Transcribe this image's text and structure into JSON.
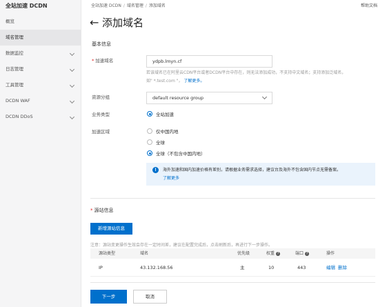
{
  "sidebar": {
    "title": "全站加速 DCDN",
    "items": [
      {
        "label": "概览",
        "expandable": false
      },
      {
        "label": "域名管理",
        "expandable": false,
        "active": true
      },
      {
        "label": "数据监控",
        "expandable": true
      },
      {
        "label": "日志管理",
        "expandable": true
      },
      {
        "label": "工具管理",
        "expandable": true
      },
      {
        "label": "DCDN WAF",
        "expandable": true
      },
      {
        "label": "DCDN DDoS",
        "expandable": true
      }
    ]
  },
  "topbar": {
    "breadcrumb": [
      "全站加速 DCDN",
      "域名管理",
      "添加域名"
    ],
    "help": "帮助文档"
  },
  "header": {
    "back": "←",
    "title": "添加域名"
  },
  "basic": {
    "section_title": "基本信息",
    "domain_label": "加速域名",
    "domain_value": "ydpb.lmyn.cf",
    "hint_line1": "若该域名已在阿里云CDN平台或者DCDN平台中存在，则无法添加成功，不支持中文域名；支持添加泛域名，",
    "hint_line2": "如\" *.test.com \"，",
    "hint_link": "了解更多。",
    "resource_label": "资源分组",
    "resource_value": "default resource group",
    "biz_label": "业务类型",
    "biz_options": [
      "全站加速"
    ],
    "region_label": "加速区域",
    "region_options": [
      "仅中国内地",
      "全球",
      "全球（不包含中国内地）"
    ],
    "info_line1": "海外加速和国内加速价格有差别，请根据业务需求选择，建议台及海外不包含国内节点无需备案。",
    "info_link": "了解更多"
  },
  "origin": {
    "section_title": "源站信息",
    "add_button": "新增源站信息",
    "note": "注意：源站变更操作生效会存在一定时间差，建议在配置完成后，点击刷新后，再进行下一步操作。",
    "columns": [
      "源站类型",
      "域名",
      "优先级",
      "权重",
      "端口",
      "操作"
    ],
    "rows": [
      {
        "type": "IP",
        "domain": "43.132.168.56",
        "priority": "主",
        "weight": "10",
        "port": "443",
        "actions": [
          "编辑",
          "删除"
        ]
      }
    ]
  },
  "footer": {
    "next": "下一步",
    "cancel": "取消"
  },
  "colors": {
    "accent": "#0070cc",
    "info_bg": "#eaf3fc"
  }
}
